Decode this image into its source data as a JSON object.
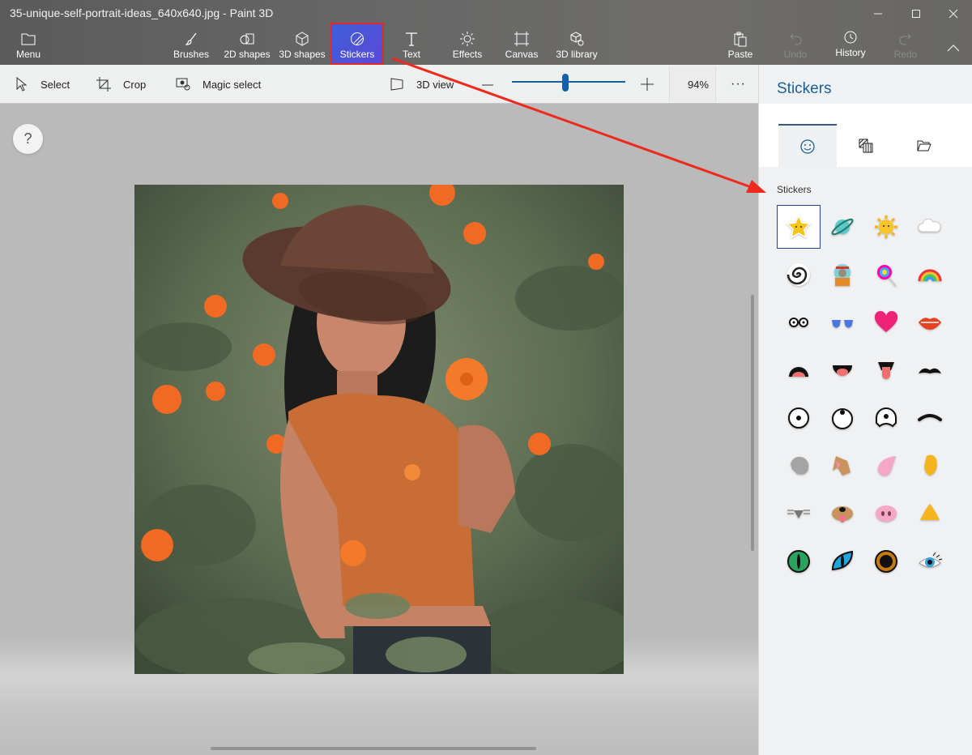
{
  "window": {
    "title": "35-unique-self-portrait-ideas_640x640.jpg - Paint 3D",
    "controls": [
      "minimize",
      "maximize",
      "close"
    ]
  },
  "ribbon": {
    "menu": {
      "label": "Menu",
      "icon": "folder-icon"
    },
    "tools": [
      {
        "label": "Brushes",
        "icon": "brush-icon"
      },
      {
        "label": "2D shapes",
        "icon": "2d-shapes-icon"
      },
      {
        "label": "3D shapes",
        "icon": "cube-icon"
      },
      {
        "label": "Stickers",
        "icon": "sticker-icon",
        "active": true
      },
      {
        "label": "Text",
        "icon": "text-icon"
      },
      {
        "label": "Effects",
        "icon": "sun-icon"
      },
      {
        "label": "Canvas",
        "icon": "canvas-icon"
      },
      {
        "label": "3D library",
        "icon": "3d-library-icon"
      }
    ],
    "actions": [
      {
        "label": "Paste",
        "icon": "clipboard-icon",
        "enabled": true
      },
      {
        "label": "Undo",
        "icon": "undo-icon",
        "enabled": false
      },
      {
        "label": "History",
        "icon": "history-icon",
        "enabled": true
      },
      {
        "label": "Redo",
        "icon": "redo-icon",
        "enabled": false
      }
    ],
    "collapse_icon": "chevron-up-icon"
  },
  "toolbar": {
    "select": "Select",
    "crop": "Crop",
    "magic_select": "Magic select",
    "view_3d": "3D view",
    "zoom_percent": "94%",
    "zoom_slider_fraction": 0.47,
    "more": "···"
  },
  "canvas": {
    "help": "?",
    "image_name": "35-unique-self-portrait-ideas_640x640.jpg"
  },
  "panel": {
    "title": "Stickers",
    "tabs": [
      {
        "name": "stickers",
        "icon": "sticker-face-icon",
        "active": true
      },
      {
        "name": "textures",
        "icon": "texture-icon",
        "active": false
      },
      {
        "name": "custom",
        "icon": "folder-open-icon",
        "active": false
      }
    ],
    "section_label": "Stickers",
    "stickers": [
      "star",
      "planet",
      "sun",
      "cloud",
      "spiral",
      "cat-astronaut",
      "lollipop",
      "rainbow",
      "glasses",
      "sunglasses",
      "heart",
      "lips",
      "open-mouth",
      "smile-mouth",
      "tongue",
      "mustache",
      "eye-center",
      "eye-up",
      "eye-worried",
      "eyebrow",
      "ear-gray",
      "ear-dog",
      "ear-pink",
      "ear-yellow",
      "nose-mouse",
      "nose-dog",
      "nose-pig",
      "nose-bird",
      "eye-cat-green",
      "eye-cat-blue",
      "eye-orange",
      "eye-lashes"
    ],
    "selected_sticker": "star"
  },
  "colors": {
    "accent": "#1b5f93",
    "active_tool": "#4a55d8",
    "annotation_red": "#e02a2a"
  }
}
